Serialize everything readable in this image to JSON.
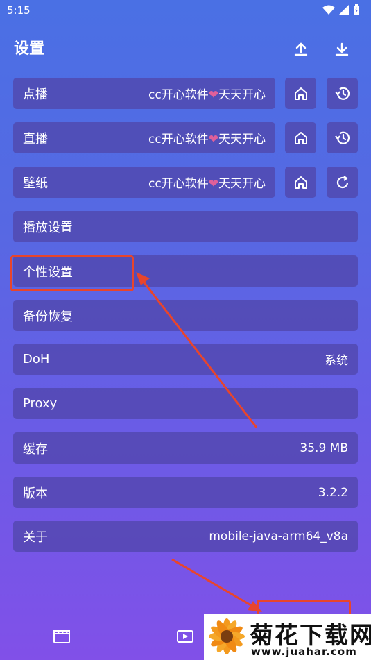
{
  "status_bar": {
    "time": "5:15"
  },
  "header": {
    "title": "设置"
  },
  "source_rows": [
    {
      "label": "点播",
      "value_prefix": "cc开心软件",
      "heart": "❤",
      "value_suffix": "天天开心",
      "action_icon": "history-icon"
    },
    {
      "label": "直播",
      "value_prefix": "cc开心软件",
      "heart": "❤",
      "value_suffix": "天天开心",
      "action_icon": "history-icon"
    },
    {
      "label": "壁纸",
      "value_prefix": "cc开心软件",
      "heart": "❤",
      "value_suffix": "天天开心",
      "action_icon": "refresh-icon"
    }
  ],
  "menu": {
    "playback": "播放设置",
    "personal": "个性设置",
    "backup": "备份恢复",
    "doh": {
      "label": "DoH",
      "value": "系统"
    },
    "proxy": {
      "label": "Proxy"
    },
    "cache": {
      "label": "缓存",
      "value": "35.9 MB"
    },
    "version": {
      "label": "版本",
      "value": "3.2.2"
    },
    "about": {
      "label": "关于",
      "value": "mobile-java-arm64_v8a"
    }
  },
  "watermark": {
    "title": "菊花下载网",
    "url": "www.juahar.com"
  },
  "colors": {
    "annotation": "#e8452c",
    "heart": "#e0609a",
    "row_bg": "#5046aa"
  }
}
